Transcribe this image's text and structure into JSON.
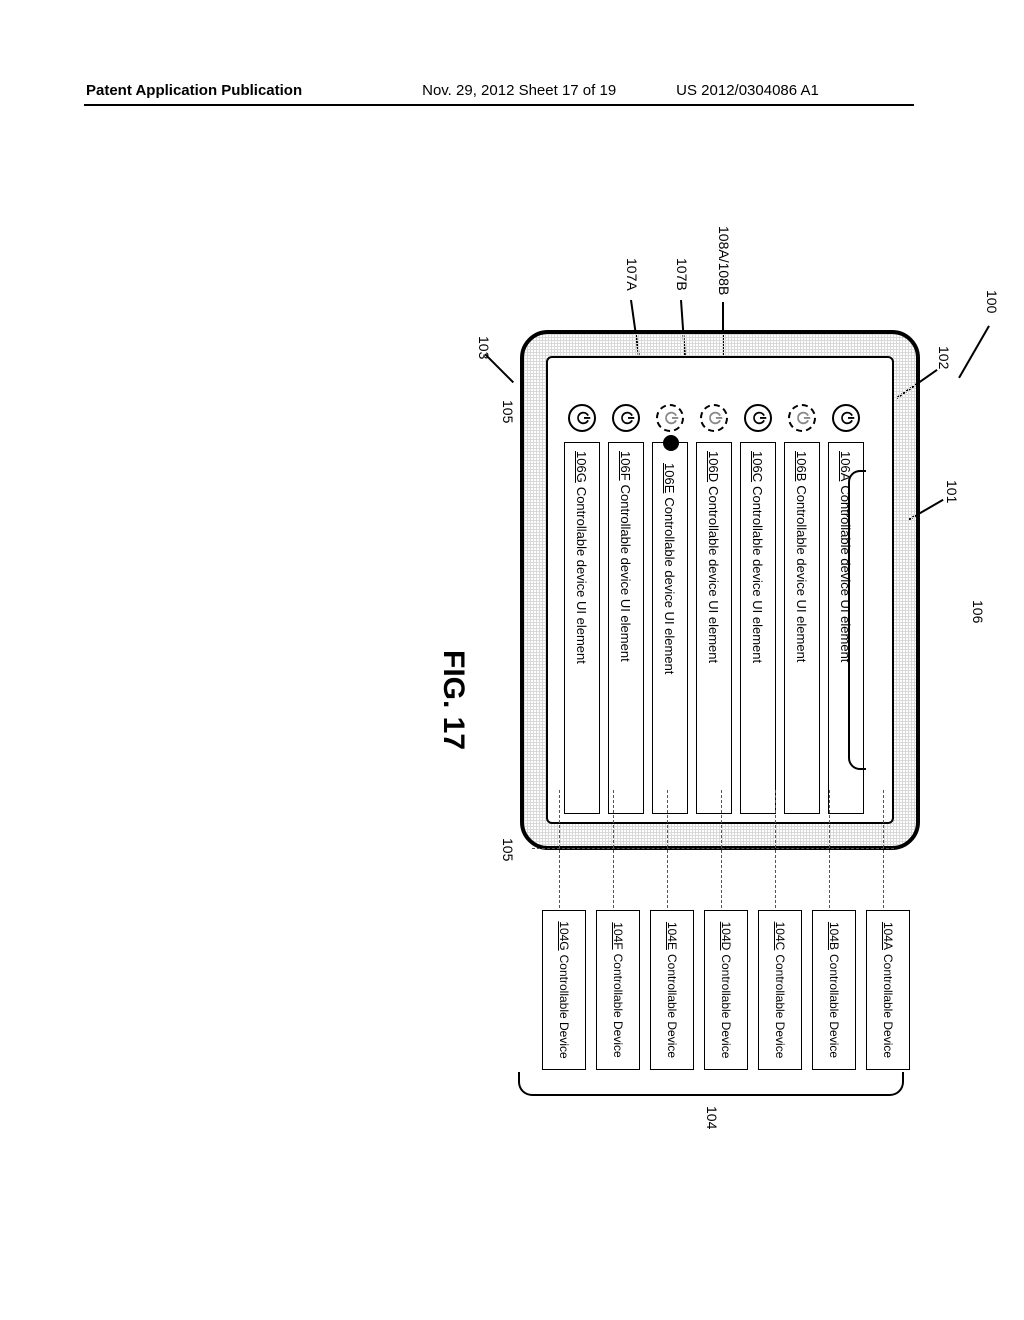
{
  "header": {
    "left": "Patent Application Publication",
    "middle": "Nov. 29, 2012  Sheet 17 of 19",
    "right": "US 2012/0304086 A1"
  },
  "figure_label": "FIG. 17",
  "refs": {
    "r100": "100",
    "r101": "101",
    "r102": "102",
    "r103": "103",
    "r104": "104",
    "r105a": "105",
    "r105b": "105",
    "r106": "106",
    "r107a": "107A",
    "r107b": "107B",
    "r108": "108A/108B"
  },
  "ui_elements": [
    {
      "id": "106A",
      "text": "Controllable device UI element",
      "toggle_on": true
    },
    {
      "id": "106B",
      "text": "Controllable device UI element",
      "toggle_on": false
    },
    {
      "id": "106C",
      "text": "Controllable device UI element",
      "toggle_on": true
    },
    {
      "id": "106D",
      "text": "Controllable device UI element",
      "toggle_on": false
    },
    {
      "id": "106E",
      "text": "Controllable device UI element",
      "toggle_on": false
    },
    {
      "id": "106F",
      "text": "Controllable device UI element",
      "toggle_on": true
    },
    {
      "id": "106G",
      "text": "Controllable device UI element",
      "toggle_on": true
    }
  ],
  "devices": [
    {
      "id": "104A",
      "text": "Controllable Device"
    },
    {
      "id": "104B",
      "text": "Controllable Device"
    },
    {
      "id": "104C",
      "text": "Controllable Device"
    },
    {
      "id": "104D",
      "text": "Controllable Device"
    },
    {
      "id": "104E",
      "text": "Controllable Device"
    },
    {
      "id": "104F",
      "text": "Controllable Device"
    },
    {
      "id": "104G",
      "text": "Controllable Device"
    }
  ],
  "toggle_glyph": "⏻"
}
